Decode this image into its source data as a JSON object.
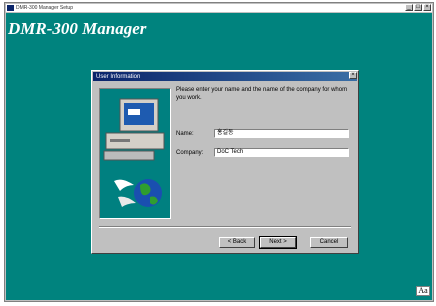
{
  "window": {
    "title": "DMR-300 Manager Setup",
    "minimize": "_",
    "maximize": "□",
    "close": "×"
  },
  "brand": "DMR-300 Manager",
  "dialog": {
    "title": "User Information",
    "close": "×",
    "prompt": "Please enter your name and the name of the company for whom you work.",
    "name_label": "Name:",
    "name_value": "홍길동",
    "company_label": "Company:",
    "company_value": "DoC Tech",
    "back_label": "< Back",
    "next_label": "Next >",
    "cancel_label": "Cancel"
  },
  "font_indicator": "Aa"
}
